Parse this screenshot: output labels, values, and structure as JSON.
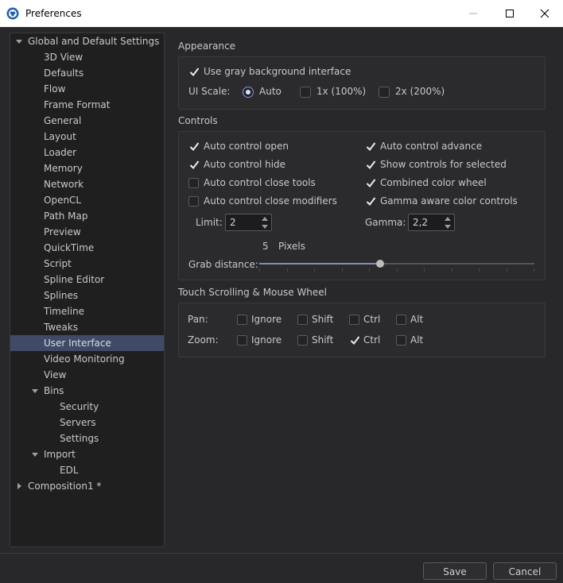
{
  "window": {
    "title": "Preferences"
  },
  "tree": {
    "items": [
      {
        "label": "Global and Default Settings",
        "level": 0,
        "expanded": true
      },
      {
        "label": "3D View",
        "level": 1
      },
      {
        "label": "Defaults",
        "level": 1
      },
      {
        "label": "Flow",
        "level": 1
      },
      {
        "label": "Frame Format",
        "level": 1
      },
      {
        "label": "General",
        "level": 1
      },
      {
        "label": "Layout",
        "level": 1
      },
      {
        "label": "Loader",
        "level": 1
      },
      {
        "label": "Memory",
        "level": 1
      },
      {
        "label": "Network",
        "level": 1
      },
      {
        "label": "OpenCL",
        "level": 1
      },
      {
        "label": "Path Map",
        "level": 1
      },
      {
        "label": "Preview",
        "level": 1
      },
      {
        "label": "QuickTime",
        "level": 1
      },
      {
        "label": "Script",
        "level": 1
      },
      {
        "label": "Spline Editor",
        "level": 1
      },
      {
        "label": "Splines",
        "level": 1
      },
      {
        "label": "Timeline",
        "level": 1
      },
      {
        "label": "Tweaks",
        "level": 1
      },
      {
        "label": "User Interface",
        "level": 1,
        "selected": true
      },
      {
        "label": "Video Monitoring",
        "level": 1
      },
      {
        "label": "View",
        "level": 1
      },
      {
        "label": "Bins",
        "level": 1,
        "expanded": true
      },
      {
        "label": "Security",
        "level": 2
      },
      {
        "label": "Servers",
        "level": 2
      },
      {
        "label": "Settings",
        "level": 2
      },
      {
        "label": "Import",
        "level": 1,
        "expanded": true
      },
      {
        "label": "EDL",
        "level": 2
      },
      {
        "label": "Composition1 *",
        "level": 0,
        "expanded": false
      }
    ]
  },
  "appearance": {
    "title": "Appearance",
    "gray_bg": {
      "label": "Use gray background interface",
      "checked": true
    },
    "ui_scale_label": "UI Scale:",
    "scale_auto": {
      "label": "Auto",
      "selected": true
    },
    "scale_1x": {
      "label": "1x (100%)",
      "selected": false
    },
    "scale_2x": {
      "label": "2x (200%)",
      "selected": false
    }
  },
  "controls": {
    "title": "Controls",
    "auto_open": {
      "label": "Auto control open",
      "checked": true
    },
    "auto_hide": {
      "label": "Auto control hide",
      "checked": true
    },
    "close_tools": {
      "label": "Auto control close tools",
      "checked": false
    },
    "close_modifiers": {
      "label": "Auto control close modifiers",
      "checked": false
    },
    "auto_advance": {
      "label": "Auto control advance",
      "checked": true
    },
    "show_selected": {
      "label": "Show controls for selected",
      "checked": true
    },
    "combined_wheel": {
      "label": "Combined color wheel",
      "checked": true
    },
    "gamma_aware": {
      "label": "Gamma aware color controls",
      "checked": true
    },
    "limit_label": "Limit:",
    "limit_value": "2",
    "gamma_label": "Gamma:",
    "gamma_value": "2,2",
    "grab_value": "5",
    "grab_unit": "Pixels",
    "grab_label": "Grab distance:",
    "grab_fraction": 0.44
  },
  "touch": {
    "title": "Touch Scrolling & Mouse Wheel",
    "pan_label": "Pan:",
    "zoom_label": "Zoom:",
    "pan": [
      {
        "label": "Ignore",
        "checked": false
      },
      {
        "label": "Shift",
        "checked": false
      },
      {
        "label": "Ctrl",
        "checked": false
      },
      {
        "label": "Alt",
        "checked": false
      }
    ],
    "zoom": [
      {
        "label": "Ignore",
        "checked": false
      },
      {
        "label": "Shift",
        "checked": false
      },
      {
        "label": "Ctrl",
        "checked": true
      },
      {
        "label": "Alt",
        "checked": false
      }
    ]
  },
  "buttons": {
    "save": "Save",
    "cancel": "Cancel"
  },
  "colors": {
    "selection": "#3e4a66",
    "accent": "#7f90b8"
  }
}
